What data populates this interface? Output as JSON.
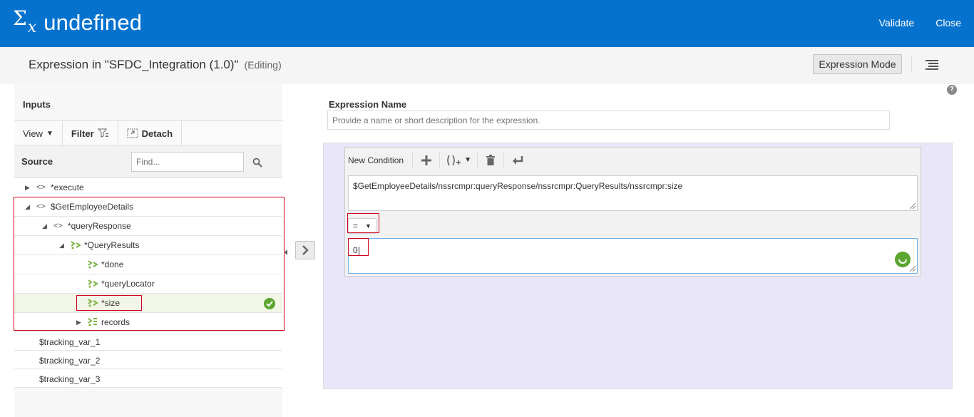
{
  "header": {
    "title": "undefined",
    "validate_label": "Validate",
    "close_label": "Close"
  },
  "subheader": {
    "title": "Expression in \"SFDC_Integration (1.0)\"",
    "status": "(Editing)",
    "mode_button": "Expression Mode"
  },
  "inputs": {
    "title": "Inputs",
    "toolbar": {
      "view": "View",
      "filter": "Filter",
      "detach": "Detach"
    },
    "source_label": "Source",
    "find_placeholder": "Find...",
    "tree": {
      "execute": "*execute",
      "get_employee": "$GetEmployeeDetails",
      "query_response": "*queryResponse",
      "query_results": "*QueryResults",
      "done": "*done",
      "query_locator": "*queryLocator",
      "size": "*size",
      "records": "records"
    },
    "tracking": [
      "$tracking_var_1",
      "$tracking_var_2",
      "$tracking_var_3"
    ]
  },
  "expression": {
    "name_label": "Expression Name",
    "name_placeholder": "Provide a name or short description for the expression.",
    "new_condition": "New Condition",
    "xpath": "$GetEmployeeDetails/nssrcmpr:queryResponse/nssrcmpr:QueryResults/nssrcmpr:size",
    "operator": "=",
    "value": "0"
  },
  "help_label": "?"
}
